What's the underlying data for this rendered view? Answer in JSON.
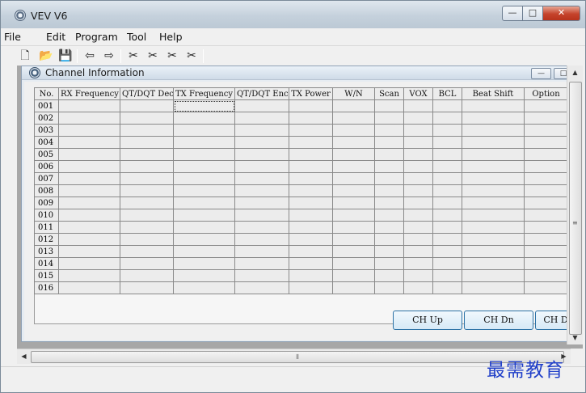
{
  "window": {
    "title": "VEV V6",
    "min_glyph": "—",
    "max_glyph": "□",
    "close_glyph": "✕"
  },
  "menu": [
    "File",
    "Edit",
    "Program",
    "Tool",
    "Help"
  ],
  "toolbar": {
    "buttons": [
      {
        "name": "new-file-icon",
        "glyph": "🗋"
      },
      {
        "name": "open-folder-icon",
        "glyph": "📂"
      },
      {
        "name": "save-disk-icon",
        "glyph": "💾"
      },
      {
        "name": "read-from-radio-icon",
        "glyph": "⇦"
      },
      {
        "name": "write-to-radio-icon",
        "glyph": "⇨"
      },
      {
        "name": "tool-1-icon",
        "glyph": "✂"
      },
      {
        "name": "tool-2-icon",
        "glyph": "✂"
      },
      {
        "name": "tool-3-icon",
        "glyph": "✂"
      },
      {
        "name": "tool-4-icon",
        "glyph": "✂"
      }
    ]
  },
  "child_window": {
    "title": "Channel Information",
    "min_glyph": "—",
    "max_glyph": "□"
  },
  "grid": {
    "columns": [
      "No.",
      "RX Frequency",
      "QT/DQT Dec",
      "TX Frequency",
      "QT/DQT Enc",
      "TX Power",
      "W/N",
      "Scan",
      "VOX",
      "BCL",
      "Beat Shift",
      "Option"
    ],
    "rows": [
      "001",
      "002",
      "003",
      "004",
      "005",
      "006",
      "007",
      "008",
      "009",
      "010",
      "011",
      "012",
      "013",
      "014",
      "015",
      "016"
    ],
    "focused_cell": {
      "row": 0,
      "column": 3
    }
  },
  "buttons": {
    "ch_up": "CH Up",
    "ch_dn": "CH Dn",
    "ch_d": "CH D"
  },
  "scrollbar": {
    "up": "▲",
    "down": "▼",
    "left": "◀",
    "right": "▶",
    "grip_v": "≡",
    "grip_h": "⦀"
  },
  "watermark": "最需教育"
}
